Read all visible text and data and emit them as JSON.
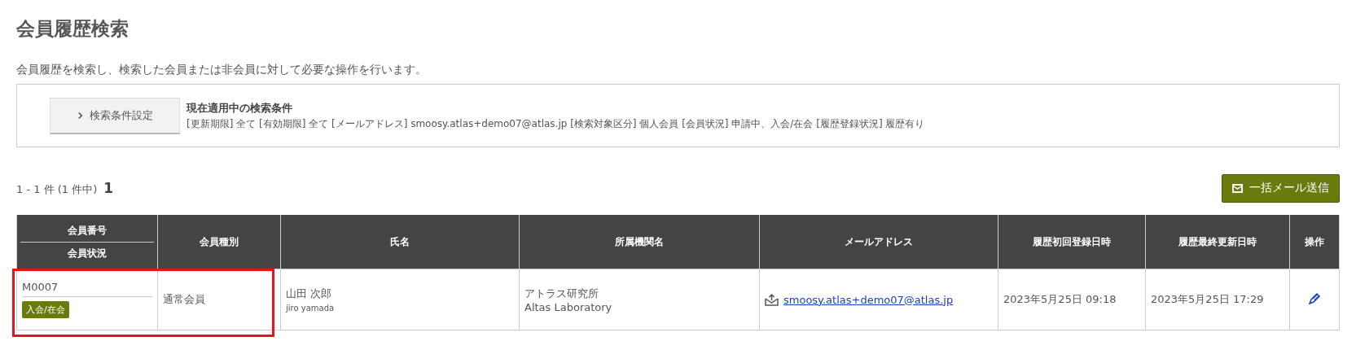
{
  "page": {
    "title": "会員履歴検索",
    "description": "会員履歴を検索し、検索した会員または非会員に対して必要な操作を行います。"
  },
  "conditions": {
    "button": "検索条件設定",
    "heading": "現在適用中の検索条件",
    "text": "[更新期限] 全て  [有効期限] 全て  [メールアドレス] smoosy.atlas+demo07@atlas.jp  [検索対象区分] 個人会員  [会員状況] 申請中、入会/在会  [履歴登録状況] 履歴有り"
  },
  "result": {
    "count": "1 - 1 件 (1 件中)",
    "page": "1",
    "bulk_mail_button": "一括メール送信"
  },
  "table": {
    "columns": [
      {
        "label": "会員番号",
        "sublabel": "会員状況"
      },
      {
        "label": "会員種別"
      },
      {
        "label": "氏名"
      },
      {
        "label": "所属機関名"
      },
      {
        "label": "メールアドレス"
      },
      {
        "label": "履歴初回登録日時"
      },
      {
        "label": "履歴最終更新日時"
      },
      {
        "label": "操作"
      }
    ],
    "rows": [
      {
        "member_no": "M0007",
        "status": "入会/在会",
        "color": "#6b7a0c",
        "type": "通常会員",
        "name": "山田 次郎",
        "name_roman": "jiro yamada",
        "org": "アトラス研究所",
        "org_en": "Altas Laboratory",
        "email": "smoosy.atlas+demo07@atlas.jp",
        "first_registered": "2023年5月25日 09:18",
        "last_updated": "2023年5月25日 17:29",
        "highlighted": true
      }
    ]
  }
}
